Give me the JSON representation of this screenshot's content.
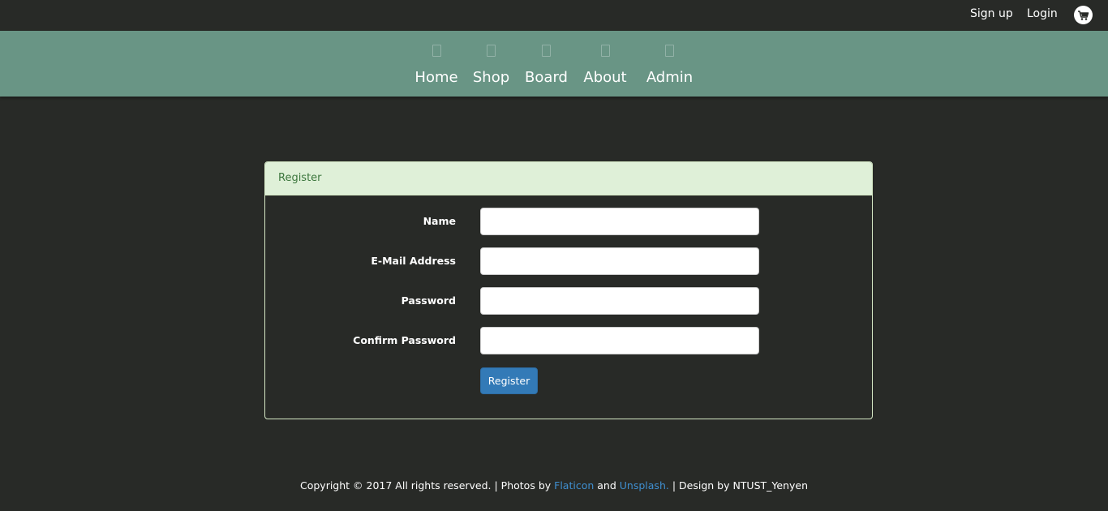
{
  "topbar": {
    "signup_label": "Sign up",
    "login_label": "Login",
    "cart_icon": "shopping-cart-icon"
  },
  "nav": {
    "items": [
      {
        "label": "Home",
        "icon": "home-icon"
      },
      {
        "label": "Shop",
        "icon": "shop-icon"
      },
      {
        "label": "Board",
        "icon": "board-icon"
      },
      {
        "label": "About",
        "icon": "about-icon"
      },
      {
        "label": "Admin",
        "icon": "admin-icon"
      }
    ]
  },
  "register": {
    "heading": "Register",
    "fields": [
      {
        "label": "Name",
        "value": ""
      },
      {
        "label": "E-Mail Address",
        "value": ""
      },
      {
        "label": "Password",
        "value": ""
      },
      {
        "label": "Confirm Password",
        "value": ""
      }
    ],
    "submit_label": "Register"
  },
  "footer": {
    "copyright": "Copyright © 2017 All rights reserved. | Photos by",
    "flaticon": "Flaticon",
    "and": "and",
    "unsplash": "Unsplash.",
    "design": "| Design by NTUST_Yenyen"
  },
  "colors": {
    "background": "#282a27",
    "navbar": "#699585",
    "panel_heading_bg": "#dff0d8",
    "panel_heading_text": "#3c763d",
    "button": "#337ab7",
    "link": "#3f8fd0"
  }
}
